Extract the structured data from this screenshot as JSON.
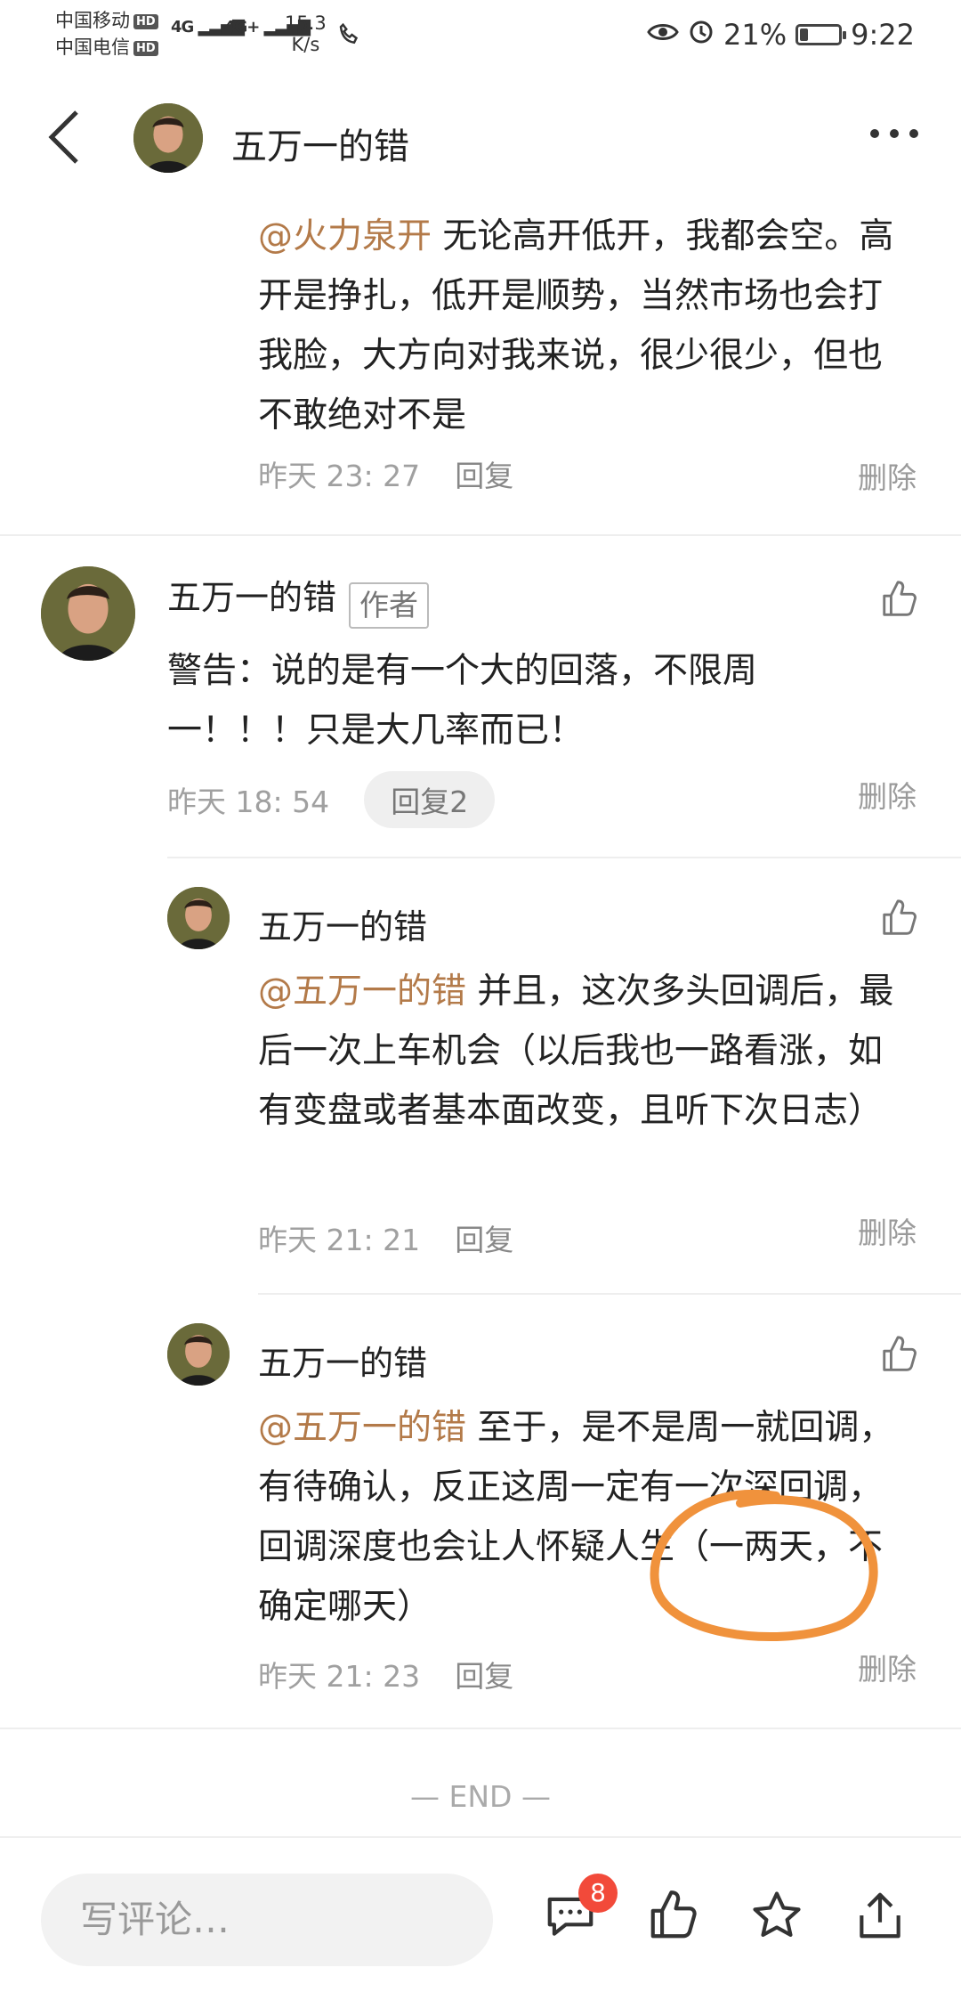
{
  "status_bar": {
    "carrier1": "中国移动",
    "carrier2": "中国电信",
    "hd": "HD",
    "net1": "4G",
    "net2": "4G+",
    "speed_value": "15.3",
    "speed_unit": "K/s",
    "battery_pct": "21%",
    "battery_level": 0.21,
    "time": "9:22"
  },
  "header": {
    "title": "五万一的错"
  },
  "comments": [
    {
      "mention": "@火力泉开",
      "text": " 无论高开低开，我都会空。高开是挣扎，低开是顺势，当然市场也会打我脸，大方向对我来说，很少很少，但也不敢绝对不是",
      "time": "昨天 23: 27",
      "reply": "回复",
      "delete": "删除"
    },
    {
      "author": "五万一的错",
      "badge": "作者",
      "text": "警告：说的是有一个大的回落，不限周一！！！只是大几率而已！",
      "time": "昨天 18: 54",
      "reply": "回复2",
      "delete": "删除"
    },
    {
      "author": "五万一的错",
      "mention": "@五万一的错",
      "text": " 并且，这次多头回调后，最后一次上车机会（以后我也一路看涨，如有变盘或者基本面改变，且听下次日志）",
      "time": "昨天 21: 21",
      "reply": "回复",
      "delete": "删除"
    },
    {
      "author": "五万一的错",
      "mention": "@五万一的错",
      "text": " 至于，是不是周一就回调，有待确认，反正这周一定有一次深回调，回调深度也会让人怀疑人生（一两天，不确定哪天）",
      "time": "昨天 21: 23",
      "reply": "回复",
      "delete": "删除"
    }
  ],
  "end_label": "— END —",
  "bottom_bar": {
    "comment_placeholder": "写评论…",
    "comment_count": "8"
  },
  "colors": {
    "mention": "#b37a49",
    "badge_red": "#f24a3a",
    "annotation_orange": "#f0923c"
  }
}
